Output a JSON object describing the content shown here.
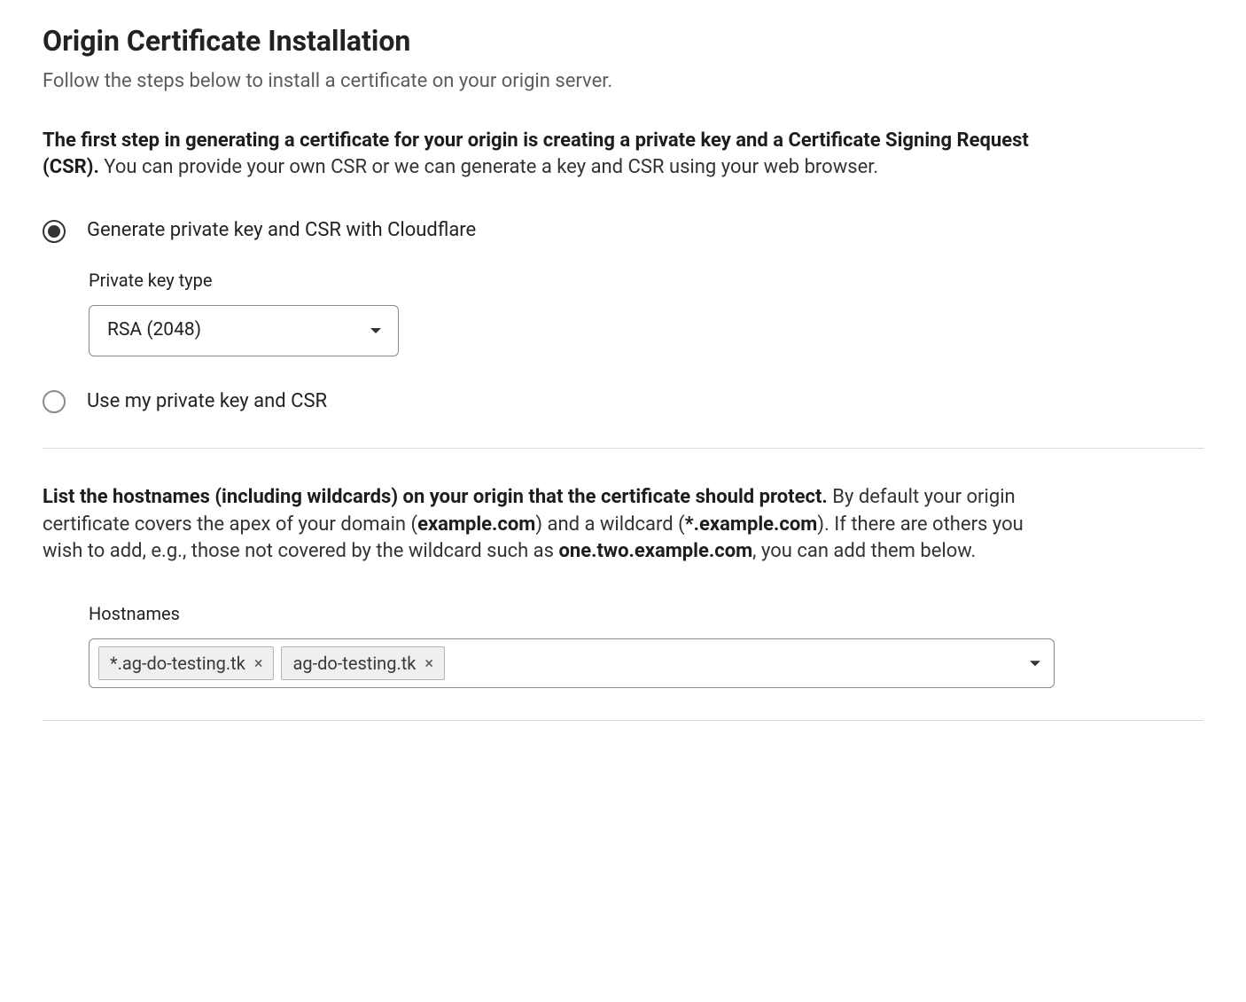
{
  "header": {
    "title": "Origin Certificate Installation",
    "subtitle": "Follow the steps below to install a certificate on your origin server."
  },
  "step1": {
    "bold": "The first step in generating a certificate for your origin is creating a private key and a Certificate Signing Request (CSR).",
    "rest": " You can provide your own CSR or we can generate a key and CSR using your web browser."
  },
  "options": {
    "generate_label": "Generate private key and CSR with Cloudflare",
    "use_own_label": "Use my private key and CSR"
  },
  "key_type": {
    "label": "Private key type",
    "value": "RSA (2048)"
  },
  "step2": {
    "bold_a": "List the hostnames (including wildcards) on your origin that the certificate should protect.",
    "rest_a": " By default your origin certificate covers the apex of your domain (",
    "bold_b": "example.com",
    "rest_b": ") and a wildcard (",
    "bold_c": "*.example.com",
    "rest_c": "). If there are others you wish to add, e.g., those not covered by the wildcard such as ",
    "bold_d": "one.two.example.com",
    "rest_d": ", you can add them below."
  },
  "hostnames": {
    "label": "Hostnames",
    "chips": [
      "*.ag-do-testing.tk",
      "ag-do-testing.tk"
    ]
  }
}
